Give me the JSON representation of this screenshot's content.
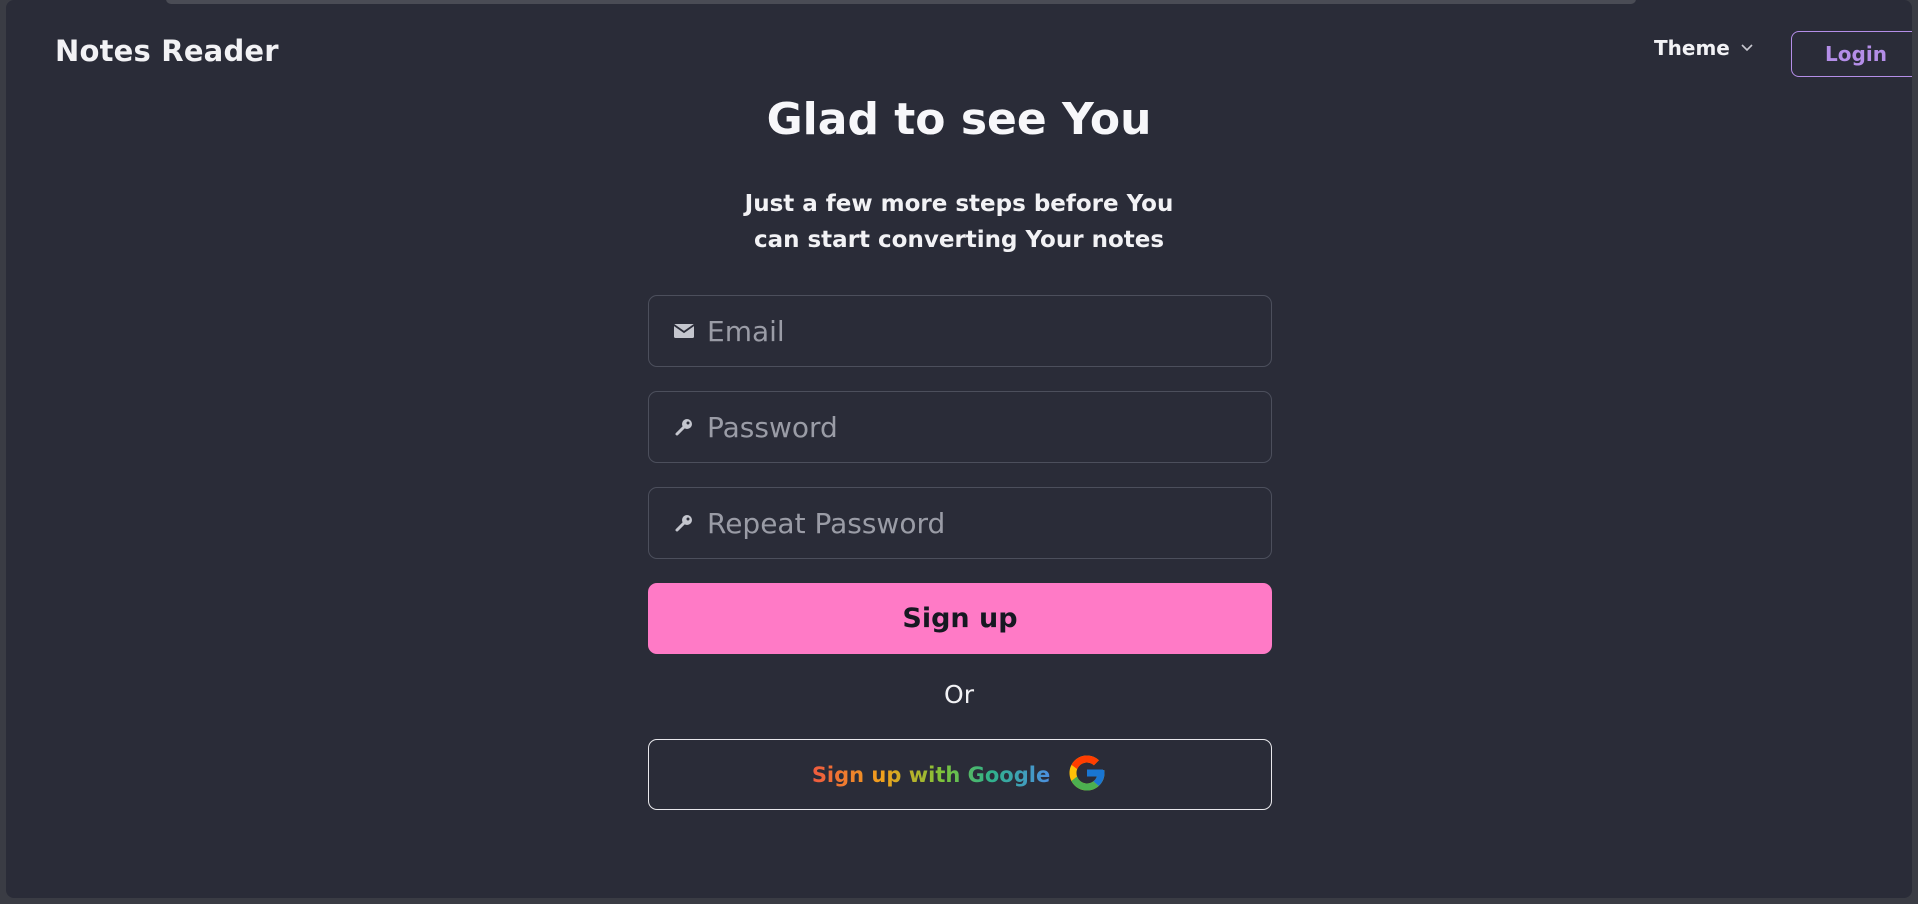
{
  "navbar": {
    "brand": "Notes Reader",
    "theme_label": "Theme",
    "login_label": "Login"
  },
  "hero": {
    "title": "Glad to see You",
    "subtitle_line1": "Just a few more steps before You",
    "subtitle_line2": "can start converting Your notes"
  },
  "form": {
    "email": {
      "placeholder": "Email",
      "value": "",
      "icon": "envelope-icon"
    },
    "password": {
      "placeholder": "Password",
      "value": "",
      "icon": "key-icon"
    },
    "repeat_password": {
      "placeholder": "Repeat Password",
      "value": "",
      "icon": "key-icon"
    },
    "submit_label": "Sign up",
    "or_label": "Or",
    "google_label": "Sign up with Google",
    "google_icon": "google-logo-icon"
  },
  "colors": {
    "background": "#2a2c38",
    "primary": "#ff7ac6",
    "accent": "#b48ee8",
    "text": "#f2f2f5"
  }
}
